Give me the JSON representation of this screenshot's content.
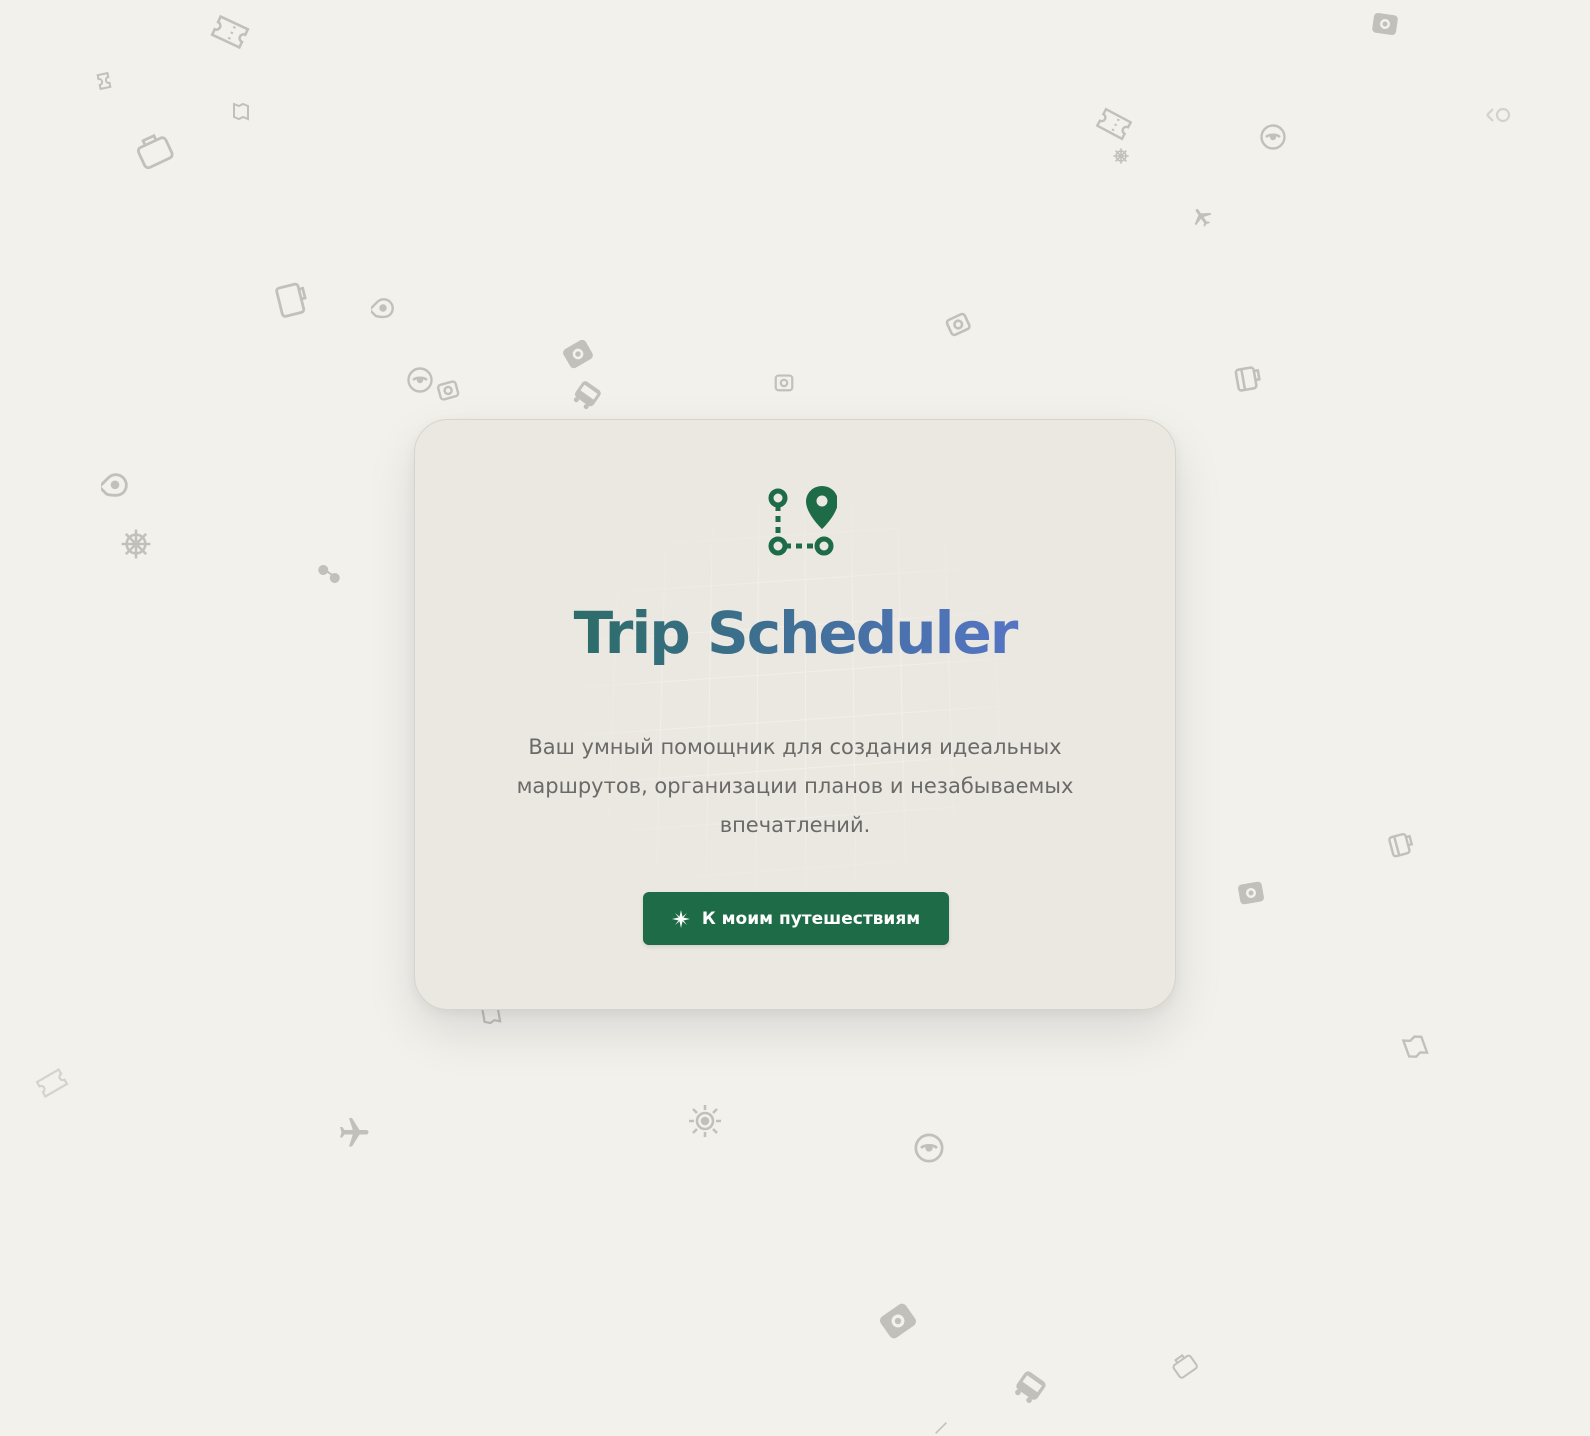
{
  "app": {
    "title": "Trip Scheduler",
    "tagline": "Ваш умный помощник для создания идеальных маршрутов, организации планов и незабываемых впечатлений."
  },
  "cta": {
    "label": "К моим путешествиям",
    "icon": "compass-rose-icon"
  },
  "logo": {
    "icon": "route-pin-icon"
  },
  "colors": {
    "background": "#f2f1ec",
    "card": "#ebe8e2",
    "brand_green": "#1e6b47",
    "title_gradient_end": "#6478e6",
    "text_muted": "#6a6a68",
    "decor_icon": "#b7b5af"
  },
  "decor_icons": [
    "ticket-icon",
    "ticket-icon",
    "map-icon",
    "suitcase-icon",
    "ticket-icon",
    "passport-icon",
    "compass-icon",
    "airplane-icon",
    "ticket-icon",
    "ship-wheel-icon",
    "suitcase-icon",
    "map-pin-icon",
    "compass-icon",
    "camera-icon",
    "passport-icon",
    "bus-icon",
    "camera-icon",
    "camera-icon",
    "suitcase-icon",
    "map-pin-icon",
    "ship-wheel-icon",
    "sunglasses-icon",
    "suitcase-icon",
    "passport-icon",
    "ticket-icon",
    "ticket-icon",
    "airplane-icon",
    "sun-icon",
    "compass-icon",
    "passport-icon",
    "bus-icon",
    "suitcase-icon",
    "map-pin-icon"
  ]
}
